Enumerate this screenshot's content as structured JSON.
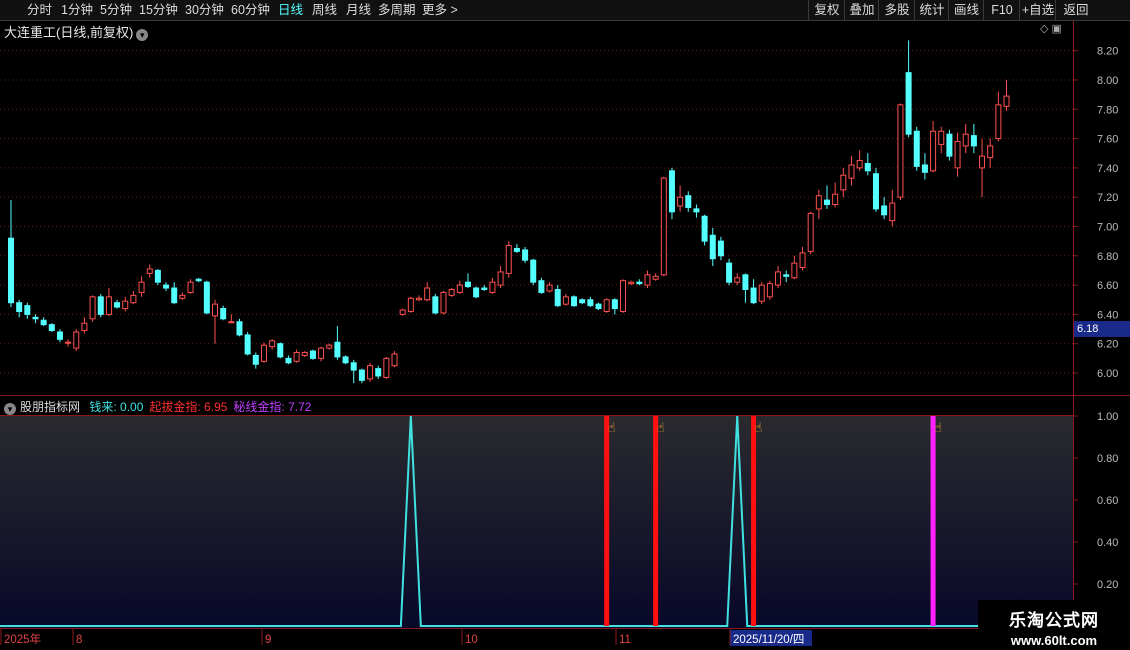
{
  "toolbar": {
    "periods": [
      "分时",
      "1分钟",
      "5分钟",
      "15分钟",
      "30分钟",
      "60分钟",
      "日线",
      "周线",
      "月线",
      "多周期",
      "更多 >"
    ],
    "active": "日线",
    "right_buttons": [
      "复权",
      "叠加",
      "多股",
      "统计",
      "画线",
      "F10",
      "+自选",
      "返回"
    ]
  },
  "main": {
    "stock_title": "大连重工(日线,前复权)",
    "current_price_tag": "6.18",
    "y_ticks": [
      "8.20",
      "8.00",
      "7.80",
      "7.60",
      "7.40",
      "7.20",
      "7.00",
      "6.80",
      "6.60",
      "6.40",
      "6.20",
      "6.00"
    ]
  },
  "indicator": {
    "name": "股朋指标网",
    "params": [
      {
        "label": "钱来: 0.00",
        "color": "#40e0e0"
      },
      {
        "label": "起拔金指: 6.95",
        "color": "#ff3030"
      },
      {
        "label": "秘线金指: 7.72",
        "color": "#c040ff"
      }
    ],
    "y_ticks": [
      "1.00",
      "0.80",
      "0.60",
      "0.40",
      "0.20"
    ]
  },
  "x_axis": {
    "labels": [
      "2025年",
      "8",
      "9",
      "10",
      "11",
      "2025/11/20/四"
    ]
  },
  "watermark": {
    "line1": "乐淘公式网",
    "line2": "www.60lt.com"
  },
  "colors": {
    "up": "#ff5050",
    "down": "#54ffff",
    "grid": "#6a1a1a",
    "signal_red": "#ff1010",
    "signal_magenta": "#ff20ff",
    "line_cyan": "#40e0e0"
  },
  "chart_data": {
    "type": "candlestick",
    "ylim": [
      5.85,
      8.3
    ],
    "candles": [
      [
        6.92,
        6.48,
        7.18,
        6.45
      ],
      [
        6.48,
        6.42,
        6.5,
        6.38
      ],
      [
        6.46,
        6.4,
        6.48,
        6.37
      ],
      [
        6.38,
        6.37,
        6.4,
        6.34
      ],
      [
        6.36,
        6.33,
        6.38,
        6.32
      ],
      [
        6.33,
        6.29,
        6.34,
        6.28
      ],
      [
        6.28,
        6.23,
        6.3,
        6.21
      ],
      [
        6.21,
        6.21,
        6.23,
        6.18
      ],
      [
        6.17,
        6.28,
        6.3,
        6.15
      ],
      [
        6.29,
        6.34,
        6.38,
        6.27
      ],
      [
        6.37,
        6.52,
        6.53,
        6.35
      ],
      [
        6.52,
        6.4,
        6.54,
        6.38
      ],
      [
        6.4,
        6.52,
        6.58,
        6.39
      ],
      [
        6.48,
        6.45,
        6.5,
        6.44
      ],
      [
        6.44,
        6.49,
        6.52,
        6.42
      ],
      [
        6.48,
        6.53,
        6.56,
        6.47
      ],
      [
        6.55,
        6.62,
        6.66,
        6.52
      ],
      [
        6.68,
        6.71,
        6.74,
        6.65
      ],
      [
        6.7,
        6.62,
        6.71,
        6.6
      ],
      [
        6.6,
        6.58,
        6.62,
        6.56
      ],
      [
        6.58,
        6.48,
        6.62,
        6.47
      ],
      [
        6.51,
        6.53,
        6.55,
        6.5
      ],
      [
        6.55,
        6.62,
        6.64,
        6.54
      ],
      [
        6.64,
        6.63,
        6.65,
        6.62
      ],
      [
        6.62,
        6.41,
        6.63,
        6.4
      ],
      [
        6.39,
        6.47,
        6.5,
        6.2
      ],
      [
        6.44,
        6.37,
        6.46,
        6.36
      ],
      [
        6.35,
        6.35,
        6.4,
        6.34
      ],
      [
        6.35,
        6.26,
        6.37,
        6.25
      ],
      [
        6.26,
        6.13,
        6.28,
        6.12
      ],
      [
        6.12,
        6.06,
        6.14,
        6.03
      ],
      [
        6.08,
        6.19,
        6.21,
        6.07
      ],
      [
        6.18,
        6.22,
        6.23,
        6.16
      ],
      [
        6.2,
        6.11,
        6.21,
        6.1
      ],
      [
        6.1,
        6.07,
        6.12,
        6.06
      ],
      [
        6.08,
        6.14,
        6.16,
        6.07
      ],
      [
        6.12,
        6.14,
        6.15,
        6.11
      ],
      [
        6.15,
        6.1,
        6.16,
        6.09
      ],
      [
        6.1,
        6.17,
        6.18,
        6.08
      ],
      [
        6.17,
        6.19,
        6.2,
        6.16
      ],
      [
        6.21,
        6.11,
        6.32,
        6.09
      ],
      [
        6.11,
        6.07,
        6.12,
        6.06
      ],
      [
        6.07,
        6.02,
        6.09,
        5.93
      ],
      [
        6.02,
        5.95,
        6.03,
        5.93
      ],
      [
        5.96,
        6.05,
        6.07,
        5.94
      ],
      [
        6.03,
        5.98,
        6.05,
        5.96
      ],
      [
        5.97,
        6.1,
        6.11,
        5.96
      ],
      [
        6.05,
        6.13,
        6.15,
        6.04
      ],
      [
        6.4,
        6.43,
        6.44,
        6.39
      ],
      [
        6.42,
        6.51,
        6.52,
        6.41
      ],
      [
        6.5,
        6.51,
        6.53,
        6.49
      ],
      [
        6.5,
        6.58,
        6.62,
        6.49
      ],
      [
        6.52,
        6.41,
        6.54,
        6.4
      ],
      [
        6.41,
        6.55,
        6.56,
        6.4
      ],
      [
        6.53,
        6.57,
        6.58,
        6.52
      ],
      [
        6.55,
        6.6,
        6.63,
        6.54
      ],
      [
        6.62,
        6.59,
        6.68,
        6.58
      ],
      [
        6.58,
        6.52,
        6.59,
        6.51
      ],
      [
        6.58,
        6.57,
        6.6,
        6.56
      ],
      [
        6.55,
        6.62,
        6.65,
        6.54
      ],
      [
        6.6,
        6.69,
        6.73,
        6.58
      ],
      [
        6.68,
        6.87,
        6.9,
        6.65
      ],
      [
        6.85,
        6.83,
        6.88,
        6.82
      ],
      [
        6.84,
        6.77,
        6.86,
        6.75
      ],
      [
        6.77,
        6.62,
        6.78,
        6.6
      ],
      [
        6.63,
        6.55,
        6.65,
        6.54
      ],
      [
        6.56,
        6.6,
        6.62,
        6.55
      ],
      [
        6.57,
        6.46,
        6.6,
        6.45
      ],
      [
        6.47,
        6.52,
        6.54,
        6.46
      ],
      [
        6.52,
        6.46,
        6.53,
        6.45
      ],
      [
        6.5,
        6.48,
        6.51,
        6.47
      ],
      [
        6.5,
        6.46,
        6.52,
        6.45
      ],
      [
        6.47,
        6.44,
        6.48,
        6.43
      ],
      [
        6.42,
        6.5,
        6.51,
        6.41
      ],
      [
        6.5,
        6.44,
        6.51,
        6.4
      ],
      [
        6.42,
        6.63,
        6.64,
        6.41
      ],
      [
        6.61,
        6.62,
        6.63,
        6.6
      ],
      [
        6.62,
        6.61,
        6.64,
        6.6
      ],
      [
        6.6,
        6.67,
        6.7,
        6.58
      ],
      [
        6.64,
        6.66,
        6.68,
        6.63
      ],
      [
        6.67,
        7.33,
        7.34,
        6.66
      ],
      [
        7.38,
        7.1,
        7.4,
        7.05
      ],
      [
        7.14,
        7.2,
        7.28,
        7.1
      ],
      [
        7.21,
        7.13,
        7.24,
        7.1
      ],
      [
        7.12,
        7.1,
        7.15,
        7.06
      ],
      [
        7.07,
        6.9,
        7.08,
        6.87
      ],
      [
        6.94,
        6.78,
        6.99,
        6.73
      ],
      [
        6.9,
        6.8,
        6.93,
        6.77
      ],
      [
        6.75,
        6.62,
        6.78,
        6.6
      ],
      [
        6.62,
        6.65,
        6.68,
        6.6
      ],
      [
        6.67,
        6.57,
        6.68,
        6.48
      ],
      [
        6.58,
        6.48,
        6.64,
        6.47
      ],
      [
        6.49,
        6.6,
        6.62,
        6.47
      ],
      [
        6.52,
        6.61,
        6.63,
        6.5
      ],
      [
        6.6,
        6.69,
        6.73,
        6.58
      ],
      [
        6.67,
        6.66,
        6.7,
        6.62
      ],
      [
        6.65,
        6.75,
        6.8,
        6.64
      ],
      [
        6.72,
        6.82,
        6.86,
        6.7
      ],
      [
        6.83,
        7.09,
        7.1,
        6.81
      ],
      [
        7.12,
        7.21,
        7.25,
        7.05
      ],
      [
        7.18,
        7.15,
        7.28,
        7.12
      ],
      [
        7.15,
        7.22,
        7.3,
        7.13
      ],
      [
        7.25,
        7.35,
        7.4,
        7.2
      ],
      [
        7.33,
        7.42,
        7.48,
        7.28
      ],
      [
        7.4,
        7.45,
        7.52,
        7.38
      ],
      [
        7.43,
        7.38,
        7.5,
        7.35
      ],
      [
        7.36,
        7.12,
        7.4,
        7.1
      ],
      [
        7.14,
        7.08,
        7.2,
        7.05
      ],
      [
        7.04,
        7.16,
        7.25,
        7.0
      ],
      [
        7.2,
        7.83,
        7.84,
        7.18
      ],
      [
        8.05,
        7.63,
        8.27,
        7.61
      ],
      [
        7.65,
        7.41,
        7.68,
        7.38
      ],
      [
        7.42,
        7.37,
        7.5,
        7.32
      ],
      [
        7.38,
        7.65,
        7.72,
        7.37
      ],
      [
        7.56,
        7.65,
        7.68,
        7.5
      ],
      [
        7.63,
        7.48,
        7.66,
        7.45
      ],
      [
        7.4,
        7.58,
        7.64,
        7.34
      ],
      [
        7.55,
        7.63,
        7.7,
        7.5
      ],
      [
        7.62,
        7.55,
        7.7,
        7.5
      ],
      [
        7.4,
        7.48,
        7.6,
        7.2
      ],
      [
        7.47,
        7.55,
        7.6,
        7.4
      ],
      [
        7.6,
        7.83,
        7.92,
        7.58
      ],
      [
        7.82,
        7.89,
        8.0,
        7.79
      ]
    ],
    "indicator_series": {
      "cyan_peaks_at_candle_index": [
        49,
        89
      ],
      "red_signal_candle_index": [
        73,
        79,
        91
      ],
      "magenta_signal_candle_index": [
        113
      ]
    }
  }
}
